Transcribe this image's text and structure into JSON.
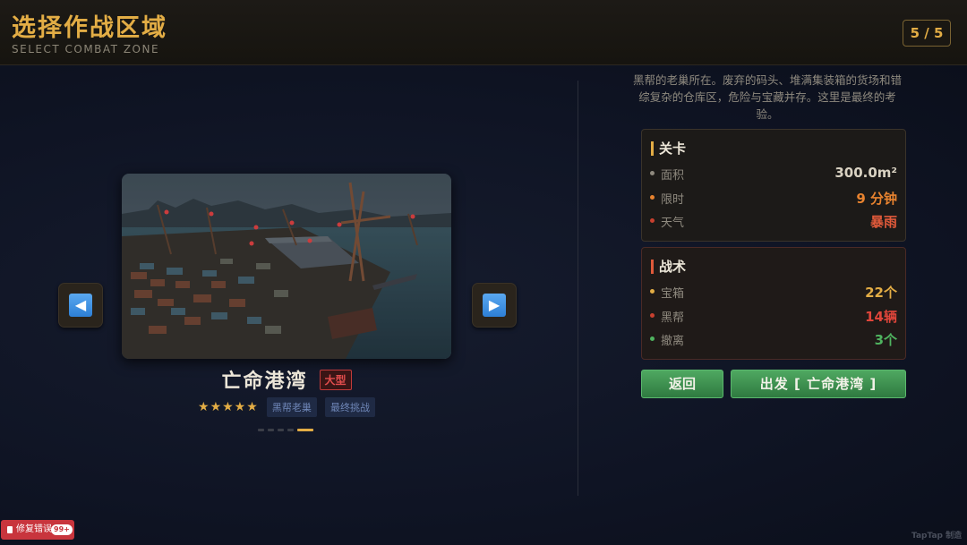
{
  "header": {
    "title": "选择作战区域",
    "subtitle": "SELECT COMBAT ZONE",
    "page_counter": "5 / 5"
  },
  "navigation": {
    "prev_icon": "left-arrow-icon",
    "next_icon": "right-arrow-icon"
  },
  "zone": {
    "name": "亡命港湾",
    "size_badge": "大型",
    "stars": "★★★★★",
    "difficulty_stars": 5,
    "tags": [
      "黑帮老巢",
      "最终挑战"
    ],
    "carousel_total": 5,
    "carousel_active_index": 4,
    "description": "黑帮的老巢所在。废弃的码头、堆满集装箱的货场和错综复杂的仓库区，危险与宝藏并存。这里是最终的考验。"
  },
  "level_card": {
    "title": "关卡",
    "rows": [
      {
        "label": "面积",
        "value": "300.0m²",
        "color": "#d9d2c2",
        "bullet": "#8f8a7f"
      },
      {
        "label": "限时",
        "value": "9 分钟",
        "color": "#e8832f",
        "bullet": "#e8832f"
      },
      {
        "label": "天气",
        "value": "暴雨",
        "color": "#e25a3a",
        "bullet": "#c8402f"
      }
    ]
  },
  "tactic_card": {
    "title": "战术",
    "rows": [
      {
        "label": "宝箱",
        "value": "22个",
        "color": "#e3ad45",
        "bullet": "#e3ad45"
      },
      {
        "label": "黑帮",
        "value": "14辆",
        "color": "#e0453a",
        "bullet": "#c8402f"
      },
      {
        "label": "撤离",
        "value": "3个",
        "color": "#4fb35f",
        "bullet": "#4fb35f"
      }
    ]
  },
  "buttons": {
    "back": "返回",
    "go": "出发 [ 亡命港湾 ]"
  },
  "overlay": {
    "bug_button": "修复错误",
    "bug_count": "99+",
    "watermark": "TapTap 制造"
  },
  "colors": {
    "accent": "#e3ad45",
    "button_green": "#3f9150",
    "background": "#0d1322"
  }
}
